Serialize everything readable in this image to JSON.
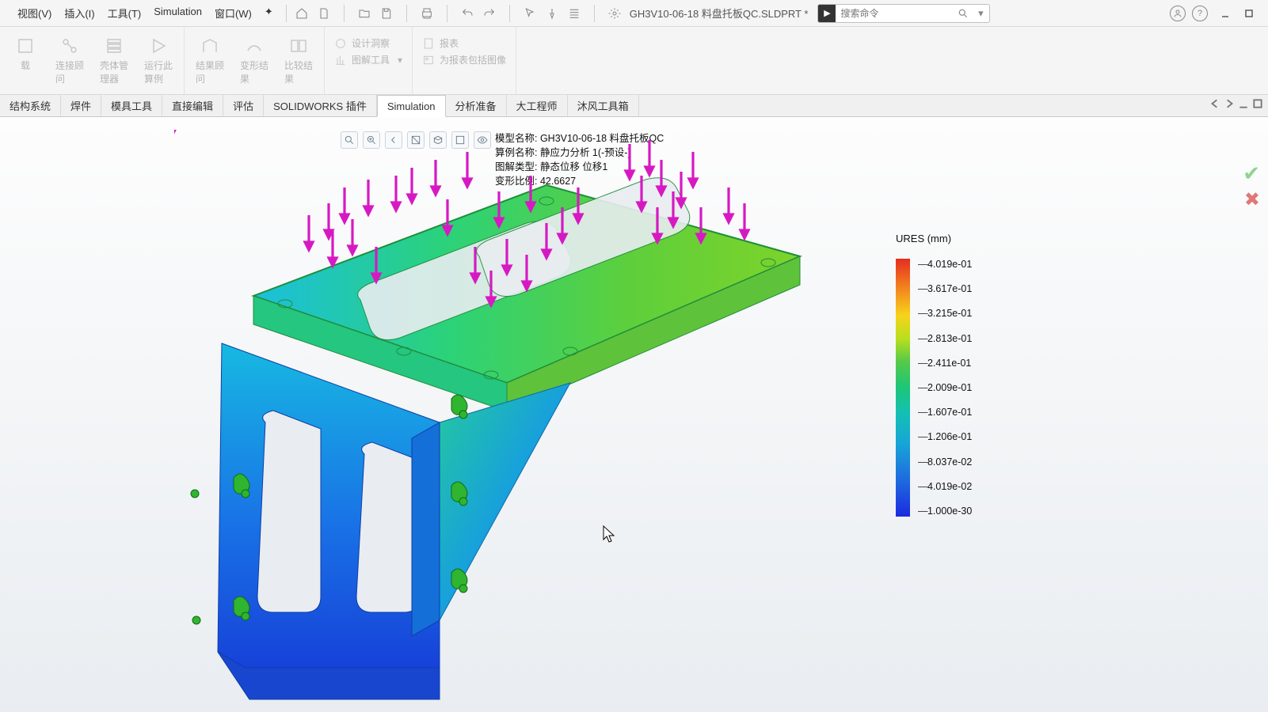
{
  "menus": {
    "view": "视图(V)",
    "insert": "插入(I)",
    "tools": "工具(T)",
    "sim": "Simulation",
    "window": "窗口(W)"
  },
  "file_title": "GH3V10-06-18 料盘托板QC.SLDPRT *",
  "search_placeholder": "搜索命令",
  "ribbon": {
    "g1": [
      "载",
      "连接顾\n问",
      "壳体管\n理器",
      "运行此\n算例"
    ],
    "g2": [
      "结果顾\n问",
      "变形结\n果",
      "比较结\n果"
    ],
    "g3": [
      "设计洞察",
      "图解工具"
    ],
    "g4": [
      "报表",
      "为报表包括图像"
    ]
  },
  "tabs": [
    "结构系统",
    "焊件",
    "模具工具",
    "直接编辑",
    "评估",
    "SOLIDWORKS 插件",
    "Simulation",
    "分析准备",
    "大工程师",
    "沐风工具箱"
  ],
  "active_tab": 6,
  "overlay": {
    "l1": "模型名称: GH3V10-06-18 料盘托板QC",
    "l2": "算例名称: 静应力分析 1(-预设-)",
    "l3": "图解类型: 静态位移 位移1",
    "l4": "变形比例: 42.6627"
  },
  "legend": {
    "title": "URES (mm)",
    "ticks": [
      "4.019e-01",
      "3.617e-01",
      "3.215e-01",
      "2.813e-01",
      "2.411e-01",
      "2.009e-01",
      "1.607e-01",
      "1.206e-01",
      "8.037e-02",
      "4.019e-02",
      "1.000e-30"
    ]
  }
}
